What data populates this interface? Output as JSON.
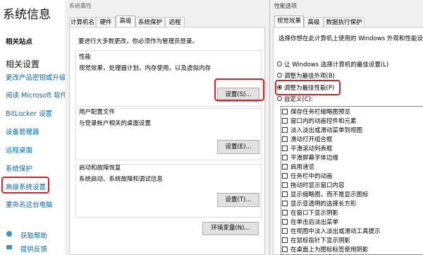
{
  "settings": {
    "title": "系统信息",
    "related_sites": "相关站点",
    "related_settings": "相关设置",
    "links": [
      "更改产品密钥或升级",
      "阅读 Microsoft 软件",
      "BitLocker 设置",
      "设备管理器",
      "远程桌面",
      "系统保护",
      "高级系统设置",
      "重命名这台电脑"
    ],
    "help": "获取帮助",
    "feedback": "提供反馈"
  },
  "sysprop": {
    "window_title": "系统属性",
    "tabs": [
      "计算机名",
      "硬件",
      "高级",
      "系统保护",
      "远程"
    ],
    "admin_note": "要进行大多数更改，你必须作为管理员登录。",
    "performance": {
      "title": "性能",
      "desc": "视觉效果，处理器计划，内存使用，以及虚拟内存",
      "button": "设置(S)..."
    },
    "user_profiles": {
      "title": "用户配置文件",
      "desc": "与登录帐户相关的桌面设置",
      "button": "设置(E)..."
    },
    "startup_recovery": {
      "title": "启动和故障恢复",
      "desc": "系统启动、系统故障和调试信息",
      "button": "设置(T)..."
    },
    "env_button": "环境变量(N)..."
  },
  "perf": {
    "window_title": "性能选项",
    "tabs": [
      "视觉效果",
      "高级",
      "数据执行保护"
    ],
    "intro": "选择你想在此计算机上使用的 Windows 外观和性能设置。",
    "options": [
      {
        "label": "让 Windows 选择计算机的最佳设置(L)",
        "selected": false
      },
      {
        "label": "调整为最佳外观(B)",
        "selected": false
      },
      {
        "label": "调整为最佳性能(P)",
        "selected": true
      },
      {
        "label": "自定义(C):",
        "selected": false
      }
    ],
    "effects": [
      "保存任务栏缩略图预览",
      "窗口内的动画控件和元素",
      "淡入淡出或滑动菜单到视图",
      "滑动打开组合框",
      "平滑滚动列表框",
      "平滑屏幕字体边缘",
      "启用速览",
      "任务栏中的动画",
      "拖动时显示窗口内容",
      "显示缩略图，而不是显示图标",
      "显示亚透明的选择长方形",
      "在窗口下显示阴影",
      "在单击后淡出菜单",
      "在视图中淡入淡出或滑动工具提示",
      "在鼠标指针下显示阴影",
      "在桌面上为图标标签使用阴影"
    ]
  },
  "colors": {
    "highlight": "#e02020",
    "link": "#0066b4"
  }
}
